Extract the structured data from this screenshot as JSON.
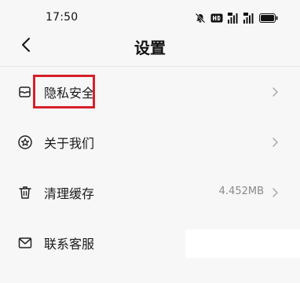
{
  "status_bar": {
    "time": "17:50",
    "icons": [
      "mute-icon",
      "hd-icon",
      "signal-4g-icon",
      "signal-5g-icon",
      "battery-icon"
    ]
  },
  "header": {
    "title": "设置",
    "back_icon": "chevron-left-icon"
  },
  "settings": {
    "items": [
      {
        "label": "隐私安全",
        "icon": "privacy-icon",
        "value": ""
      },
      {
        "label": "关于我们",
        "icon": "about-icon",
        "value": ""
      },
      {
        "label": "清理缓存",
        "icon": "trash-icon",
        "value": "4.452MB"
      },
      {
        "label": "联系客服",
        "icon": "mail-icon",
        "value": ""
      }
    ]
  },
  "colors": {
    "highlight": "#d6202a",
    "background": "#f7f7f7"
  }
}
